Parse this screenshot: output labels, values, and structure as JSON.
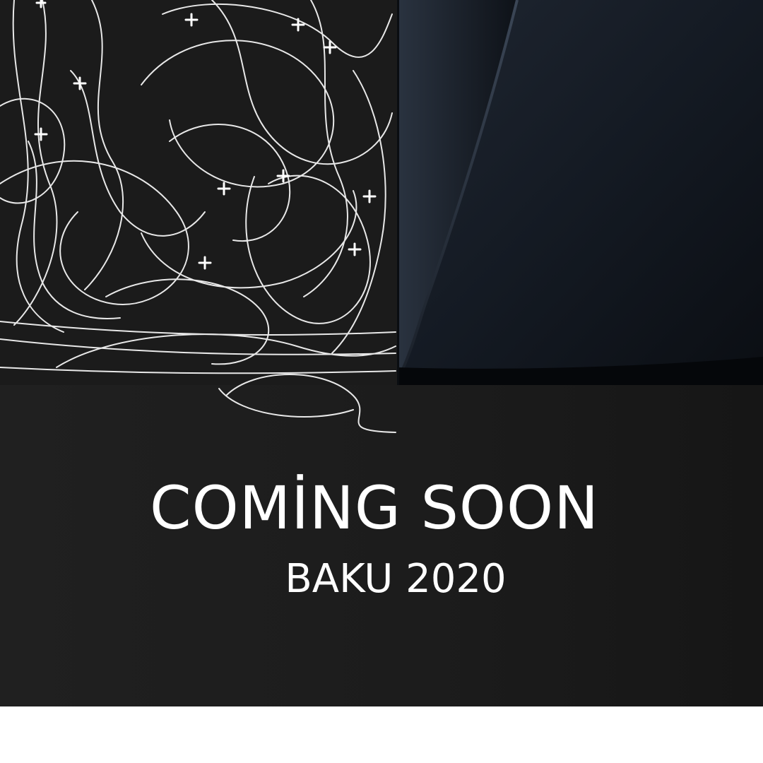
{
  "poster": {
    "headline": "COMİNG SOON",
    "subline": "BAKU 2020"
  },
  "colors": {
    "background": "#1d1d1d",
    "panel": "#141a22",
    "text": "#ffffff",
    "bottom_strip": "#ffffff"
  },
  "icons": [
    "plus-mark-icon"
  ]
}
